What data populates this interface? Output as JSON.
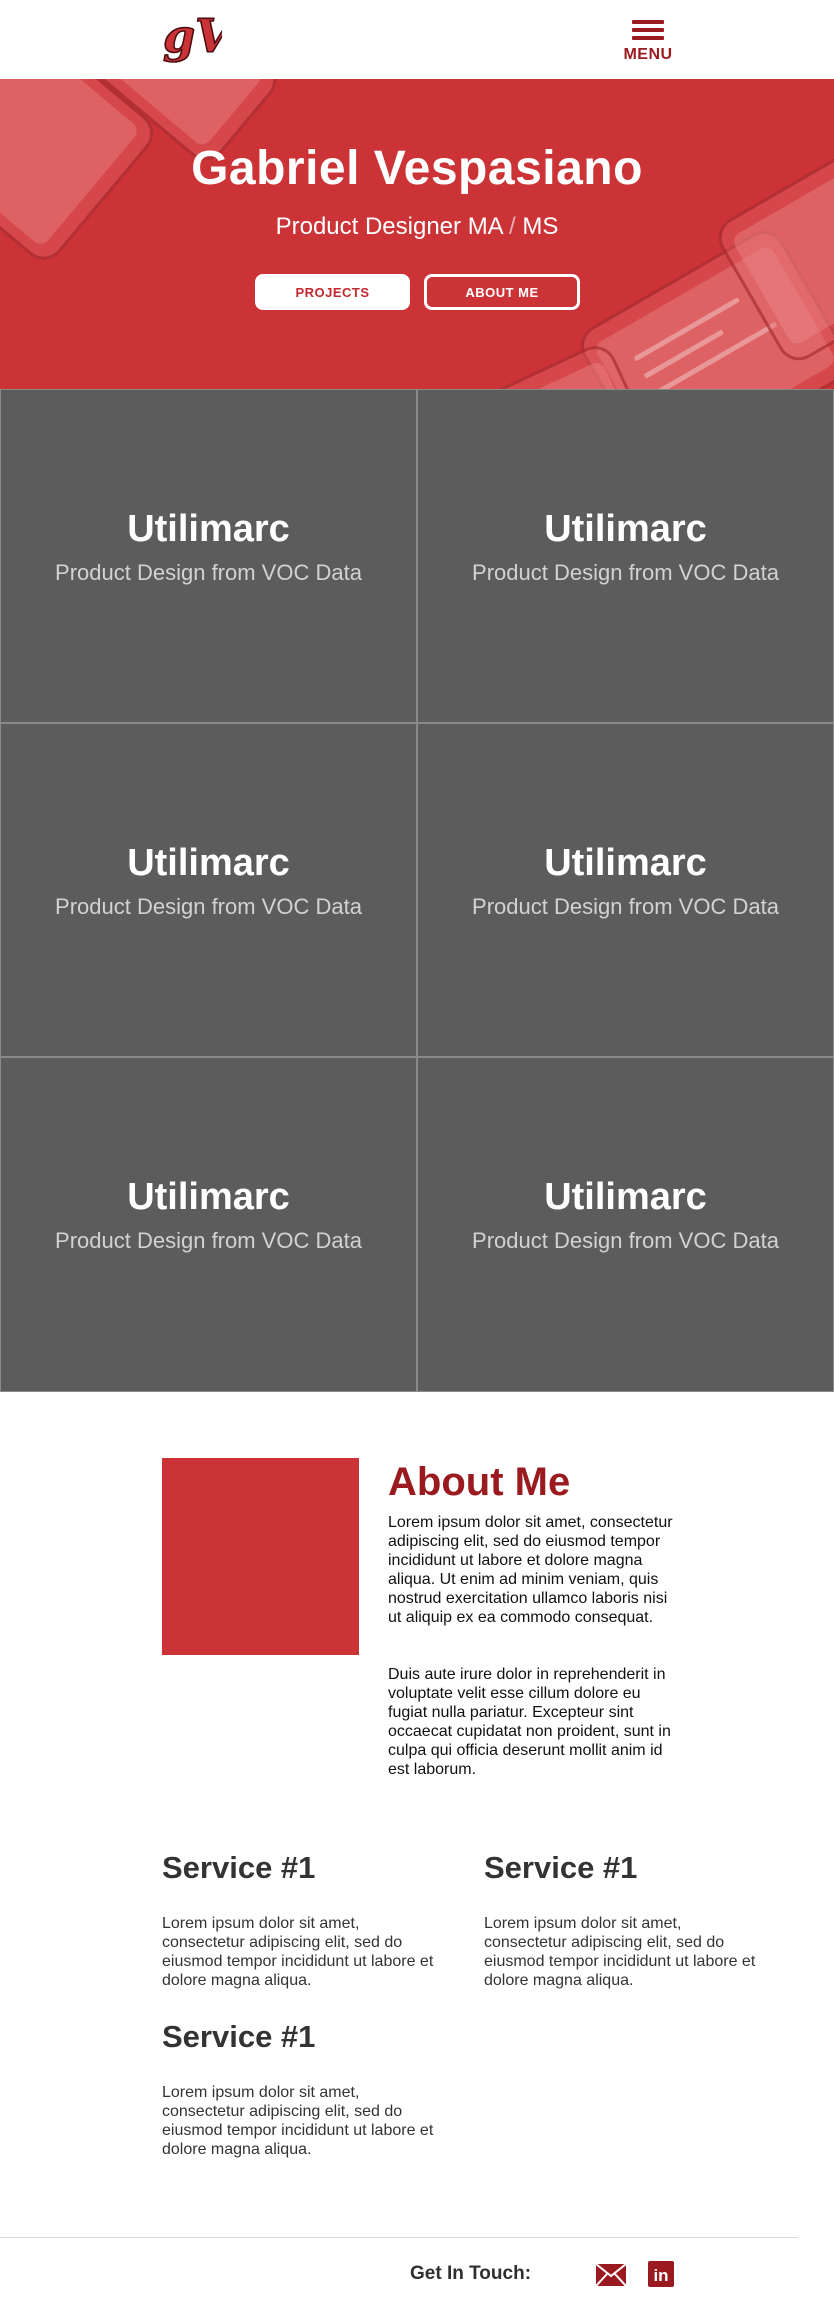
{
  "header": {
    "logo_text": "gV",
    "menu_label": "MENU"
  },
  "hero": {
    "name": "Gabriel Vespasiano",
    "subtitle_part1": "Product Designer MA",
    "subtitle_sep": "/",
    "subtitle_part2": "MS",
    "projects_button": "PROJECTS",
    "about_button": "ABOUT ME"
  },
  "projects": [
    {
      "title": "Utilimarc",
      "subtitle": "Product Design from VOC Data"
    },
    {
      "title": "Utilimarc",
      "subtitle": "Product Design from VOC Data"
    },
    {
      "title": "Utilimarc",
      "subtitle": "Product Design from VOC Data"
    },
    {
      "title": "Utilimarc",
      "subtitle": "Product Design from VOC Data"
    },
    {
      "title": "Utilimarc",
      "subtitle": "Product Design from VOC Data"
    },
    {
      "title": "Utilimarc",
      "subtitle": "Product Design from VOC Data"
    }
  ],
  "about": {
    "title": "About Me",
    "paragraph1": "Lorem ipsum dolor sit amet, consectetur adipiscing elit, sed do eiusmod tempor incididunt ut labore et dolore magna aliqua. Ut enim ad minim veniam, quis nostrud exercitation ullamco laboris nisi ut aliquip ex ea commodo consequat.",
    "paragraph2": "Duis aute irure dolor in reprehenderit in voluptate velit esse cillum dolore eu fugiat nulla pariatur. Excepteur sint occaecat cupidatat non proident, sunt in culpa qui officia deserunt mollit anim id est laborum."
  },
  "services": [
    {
      "title": "Service #1",
      "text": "Lorem ipsum dolor sit amet, consectetur adipiscing elit, sed do eiusmod tempor incididunt ut labore et dolore magna aliqua."
    },
    {
      "title": "Service #1",
      "text": "Lorem ipsum dolor sit amet, consectetur adipiscing elit, sed do eiusmod tempor incididunt ut labore et dolore magna aliqua."
    },
    {
      "title": "Service #1",
      "text": "Lorem ipsum dolor sit amet, consectetur adipiscing elit, sed do eiusmod tempor incididunt ut labore et dolore magna aliqua."
    }
  ],
  "footer": {
    "get_in_touch": "Get In Touch:",
    "linkedin_glyph": "in"
  },
  "colors": {
    "brand_red": "#cc3336",
    "dark_red": "#9b1a1f",
    "tile_gray": "#5c5c5c"
  },
  "icons": [
    "menu-icon",
    "mail-icon",
    "linkedin-icon"
  ]
}
